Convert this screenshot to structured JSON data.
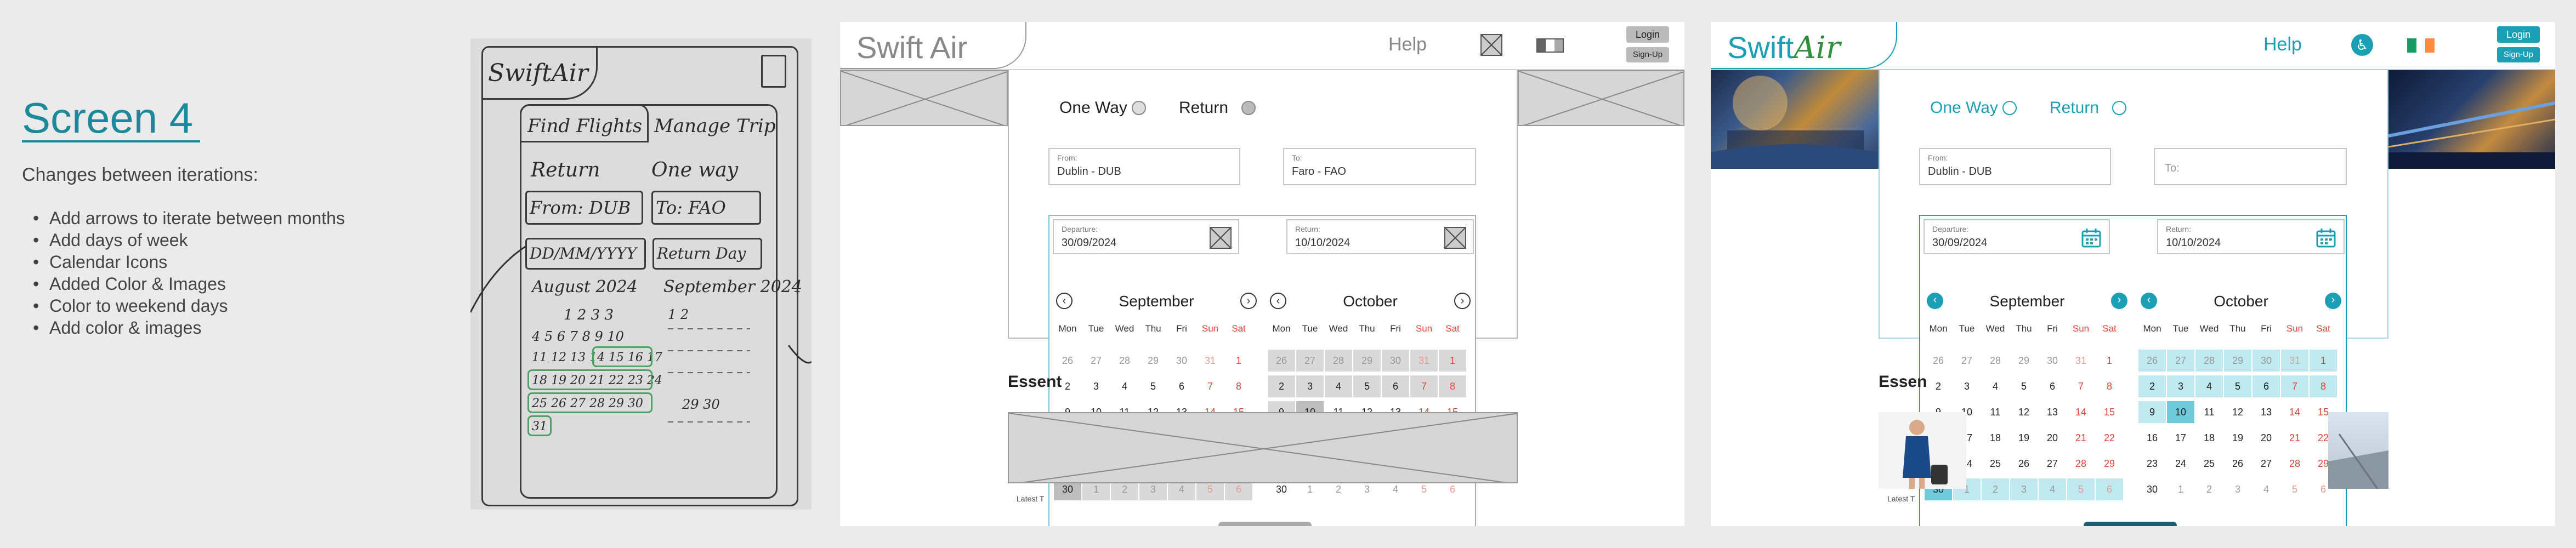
{
  "notes": {
    "title": "Screen 4",
    "heading": "Changes between iterations:",
    "changes": [
      "Add arrows to iterate between months",
      "Add days of week",
      "Calendar Icons",
      "Added Color & Images",
      "Color to weekend days",
      "Add color & images"
    ]
  },
  "sketch": {
    "logo": "SwiftAir",
    "tab1": "Find Flights",
    "tab2": "Manage Trip",
    "radio1": "Return",
    "radio2": "One way",
    "from": "From: DUB",
    "to": "To: FAO",
    "date": "DD/MM/YYYY",
    "return": "Return Day",
    "month1": "August 2024",
    "month2": "September 2024",
    "nums1": "1 2 3 3",
    "nums2": "4 5 6 7 8 9 10",
    "nums3": "11 12 13 14 15 16 17",
    "nums4": "18 19 20 21 22 23 24",
    "nums5": "25 26 27 28 29 30",
    "nums6": "31",
    "num7": "1 2",
    "num8": "29 30"
  },
  "wireframe": {
    "logo": "Swift Air",
    "help": "Help",
    "login": "Login",
    "signup": "Sign-Up",
    "one_way": "One Way",
    "return": "Return",
    "from_label": "From:",
    "from_value": "Dublin - DUB",
    "to_label": "To:",
    "to_value": "Faro - FAO",
    "departure_label": "Departure:",
    "departure_value": "30/09/2024",
    "return_label": "Return:",
    "return_value": "10/10/2024",
    "essentials": "Essent",
    "latest": "Latest T"
  },
  "hifi": {
    "logo_swift": "Swift",
    "logo_air": "Air",
    "help": "Help",
    "login": "Login",
    "signup": "Sign-Up",
    "one_way": "One Way",
    "return": "Return",
    "from_label": "From:",
    "from_value": "Dublin - DUB",
    "to_placeholder": "To:",
    "departure_label": "Departure:",
    "departure_value": "30/09/2024",
    "return_label": "Return:",
    "return_value": "10/10/2024",
    "essentials": "Essen",
    "latest": "Latest T"
  },
  "calendar": {
    "weekdays": [
      "Mon",
      "Tue",
      "Wed",
      "Thu",
      "Fri",
      "Sun",
      "Sat"
    ],
    "months": [
      {
        "name": "September",
        "weeks": [
          [
            "26",
            "27",
            "28",
            "29",
            "30",
            "31",
            "1"
          ],
          [
            "2",
            "3",
            "4",
            "5",
            "6",
            "7",
            "8"
          ],
          [
            "9",
            "10",
            "11",
            "12",
            "13",
            "14",
            "15"
          ],
          [
            "16",
            "17",
            "18",
            "19",
            "20",
            "21",
            "22"
          ],
          [
            "23",
            "24",
            "25",
            "26",
            "27",
            "28",
            "29"
          ],
          [
            "30",
            "1",
            "2",
            "3",
            "4",
            "5",
            "6"
          ]
        ]
      },
      {
        "name": "October",
        "weeks": [
          [
            "26",
            "27",
            "28",
            "29",
            "30",
            "31",
            "1"
          ],
          [
            "2",
            "3",
            "4",
            "5",
            "6",
            "7",
            "8"
          ],
          [
            "9",
            "10",
            "11",
            "12",
            "13",
            "14",
            "15"
          ],
          [
            "16",
            "17",
            "18",
            "19",
            "20",
            "21",
            "22"
          ],
          [
            "23",
            "24",
            "25",
            "26",
            "27",
            "28",
            "29"
          ],
          [
            "30",
            "1",
            "2",
            "3",
            "4",
            "5",
            "6"
          ]
        ]
      }
    ]
  },
  "colors": {
    "accent": "#1a9fb5",
    "weekend": "#e0443a",
    "range_hifi": "#bfe9ef",
    "range_wire": "#d9d9d9",
    "flag_green": "#169b62",
    "flag_orange": "#ff883e"
  }
}
